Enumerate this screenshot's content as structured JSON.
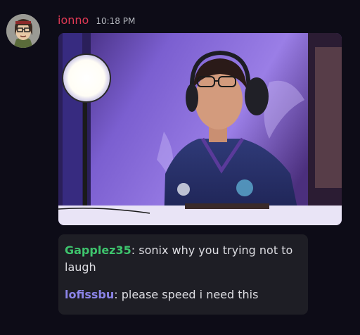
{
  "message": {
    "username": "ionno",
    "timestamp": "10:18 PM",
    "colors": {
      "username": "#e23a55",
      "chat_user_1": "#3ec46d",
      "chat_user_2": "#8b84e8"
    }
  },
  "chat": [
    {
      "user": "Gapplez35",
      "separator": ": ",
      "text": "sonix why you trying not to laugh"
    },
    {
      "user": "lofissbu",
      "separator": ": ",
      "text": "please speed i need this"
    }
  ]
}
